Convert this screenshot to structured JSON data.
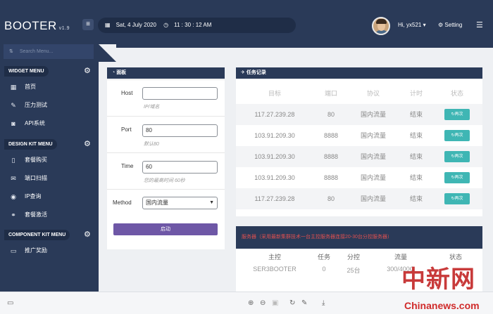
{
  "header": {
    "logo": "BOOTER",
    "version": "v1.9",
    "date": "Sat, 4 July 2020",
    "time": "11 : 30 : 12 AM",
    "greeting": "Hi, yx521",
    "setting_label": "Setting"
  },
  "sidebar": {
    "search_placeholder": "Search Menu...",
    "sections": [
      {
        "title": "WIDGET MENU",
        "items": [
          "首页",
          "压力测试",
          "API系统"
        ]
      },
      {
        "title": "DESIGN KIT MENU",
        "items": [
          "套餐购买",
          "端口扫描",
          "IP查询",
          "套餐激活"
        ]
      },
      {
        "title": "COMPONENT KIT MENU",
        "items": [
          "推广奖励"
        ]
      }
    ]
  },
  "panel": {
    "title": "面板",
    "host_label": "Host",
    "host_value": "",
    "host_help": "IP/域名",
    "port_label": "Port",
    "port_value": "80",
    "port_help": "默认80",
    "time_label": "Time",
    "time_value": "60",
    "time_help": "您的最高时间 60秒",
    "method_label": "Method",
    "method_value": "国内流量",
    "start_label": "启动"
  },
  "tasks": {
    "title": "任务记录",
    "columns": [
      "目标",
      "端口",
      "协议",
      "计时",
      "状态"
    ],
    "rows": [
      {
        "target": "117.27.239.28",
        "port": "80",
        "protocol": "国内流量",
        "timer": "结束",
        "status": "再次"
      },
      {
        "target": "103.91.209.30",
        "port": "8888",
        "protocol": "国内流量",
        "timer": "结束",
        "status": "再次"
      },
      {
        "target": "103.91.209.30",
        "port": "8888",
        "protocol": "国内流量",
        "timer": "结束",
        "status": "再次"
      },
      {
        "target": "103.91.209.30",
        "port": "8888",
        "protocol": "国内流量",
        "timer": "结束",
        "status": "再次"
      },
      {
        "target": "117.27.239.28",
        "port": "80",
        "protocol": "国内流量",
        "timer": "结束",
        "status": "再次"
      }
    ]
  },
  "servers": {
    "title": "服务器（采用最新集群技术一台主控服务器连接20-30台分控服务器）",
    "columns": [
      "主控",
      "任务",
      "分控",
      "流量",
      "状态"
    ],
    "row": {
      "name": "SER3BOOTER",
      "tasks": "0",
      "branches": "25台",
      "traffic": "300/400G"
    }
  },
  "watermark": {
    "cn": "中新网",
    "en": "Chinanews.com"
  },
  "colors": {
    "navy": "#2a3a58",
    "purple": "#6e57a6",
    "teal": "#3fb6b4",
    "red": "#e05050"
  }
}
